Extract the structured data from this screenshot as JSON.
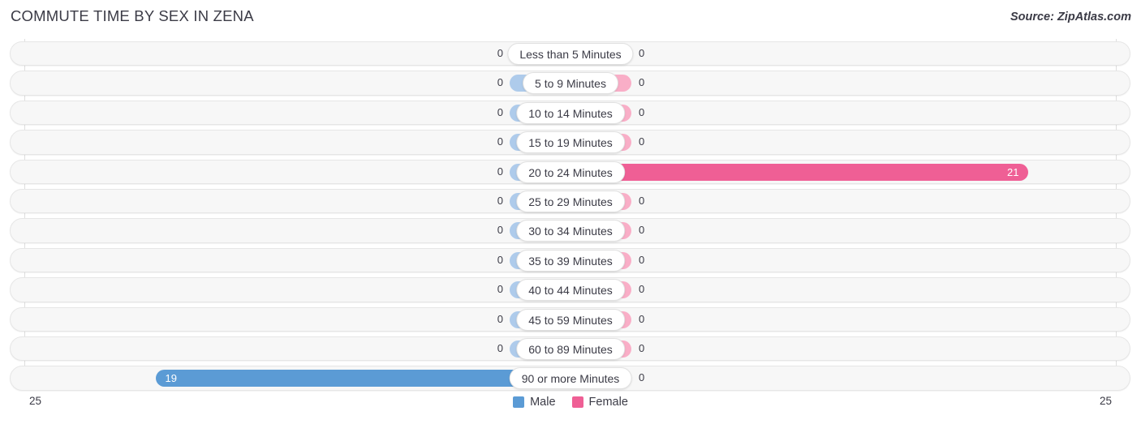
{
  "header": {
    "title": "COMMUTE TIME BY SEX IN ZENA",
    "source": "Source: ZipAtlas.com"
  },
  "axis": {
    "left_tick": "25",
    "right_tick": "25"
  },
  "legend": {
    "items": [
      {
        "label": "Male",
        "color": "#5b9bd5"
      },
      {
        "label": "Female",
        "color": "#ef5f95"
      }
    ]
  },
  "colors": {
    "male_active": "#5b9bd5",
    "male_zero": "#aecbeb",
    "female_active": "#ef5f95",
    "female_zero": "#f9aec7",
    "track": "#f7f7f7",
    "text": "#3b3b46"
  },
  "chart_data": {
    "type": "bar",
    "subtype": "diverging-horizontal-bar",
    "title": "COMMUTE TIME BY SEX IN ZENA",
    "xlabel": "",
    "ylabel": "",
    "xlim": [
      -25,
      25
    ],
    "axis_max": 25,
    "grid": true,
    "legend_position": "bottom-center",
    "categories": [
      "Less than 5 Minutes",
      "5 to 9 Minutes",
      "10 to 14 Minutes",
      "15 to 19 Minutes",
      "20 to 24 Minutes",
      "25 to 29 Minutes",
      "30 to 34 Minutes",
      "35 to 39 Minutes",
      "40 to 44 Minutes",
      "45 to 59 Minutes",
      "60 to 89 Minutes",
      "90 or more Minutes"
    ],
    "series": [
      {
        "name": "Male",
        "direction": "left",
        "color": "#5b9bd5",
        "values": [
          0,
          0,
          0,
          0,
          0,
          0,
          0,
          0,
          0,
          0,
          0,
          19
        ],
        "labels": [
          "0",
          "0",
          "0",
          "0",
          "0",
          "0",
          "0",
          "0",
          "0",
          "0",
          "0",
          "19"
        ]
      },
      {
        "name": "Female",
        "direction": "right",
        "color": "#ef5f95",
        "values": [
          0,
          0,
          0,
          0,
          21,
          0,
          0,
          0,
          0,
          0,
          0,
          0
        ],
        "labels": [
          "0",
          "0",
          "0",
          "0",
          "21",
          "0",
          "0",
          "0",
          "0",
          "0",
          "0",
          "0"
        ]
      }
    ]
  }
}
